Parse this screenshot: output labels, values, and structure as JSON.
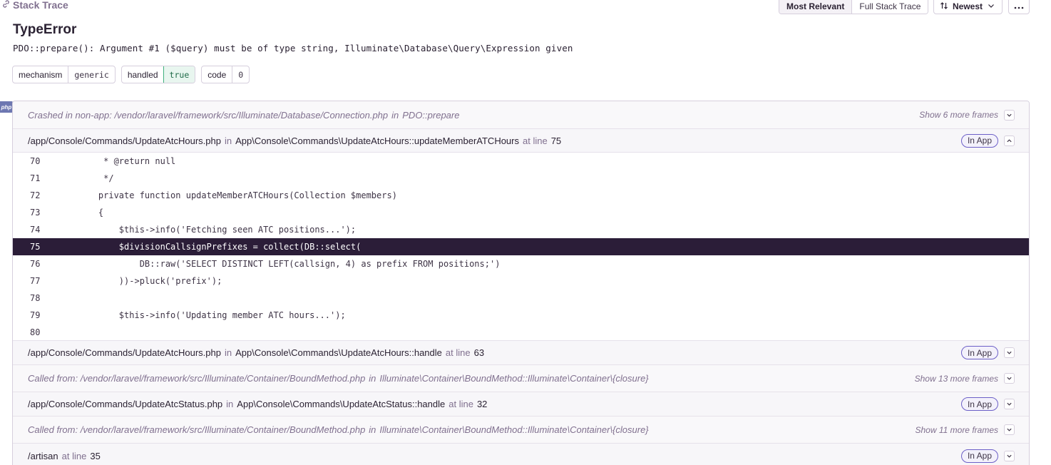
{
  "header": {
    "title": "Stack Trace",
    "view_options": [
      "Most Relevant",
      "Full Stack Trace"
    ],
    "sort_label": "Newest"
  },
  "error": {
    "type": "TypeError",
    "message": "PDO::prepare(): Argument #1 ($query) must be of type string, Illuminate\\Database\\Query\\Expression given"
  },
  "tags": [
    {
      "key": "mechanism",
      "value": "generic"
    },
    {
      "key": "handled",
      "value": "true"
    },
    {
      "key": "code",
      "value": "0"
    }
  ],
  "platform": "php",
  "frames": [
    {
      "kind": "system",
      "prefix": "Crashed in non-app:",
      "file": "/vendor/laravel/framework/src/Illuminate/Database/Connection.php",
      "in": "in",
      "function": "PDO::prepare",
      "more": "Show 6 more frames"
    },
    {
      "kind": "app",
      "file": "/app/Console/Commands/UpdateAtcHours.php",
      "in": "in",
      "function": "App\\Console\\Commands\\UpdateAtcHours::updateMemberATCHours",
      "at": "at line",
      "line": "75",
      "badge": "In App"
    },
    {
      "kind": "app",
      "file": "/app/Console/Commands/UpdateAtcHours.php",
      "in": "in",
      "function": "App\\Console\\Commands\\UpdateAtcHours::handle",
      "at": "at line",
      "line": "63",
      "badge": "In App"
    },
    {
      "kind": "system",
      "prefix": "Called from:",
      "file": "/vendor/laravel/framework/src/Illuminate/Container/BoundMethod.php",
      "in": "in",
      "function": "Illuminate\\Container\\BoundMethod::Illuminate\\Container\\{closure}",
      "more": "Show 13 more frames"
    },
    {
      "kind": "app",
      "file": "/app/Console/Commands/UpdateAtcStatus.php",
      "in": "in",
      "function": "App\\Console\\Commands\\UpdateAtcStatus::handle",
      "at": "at line",
      "line": "32",
      "badge": "In App"
    },
    {
      "kind": "system",
      "prefix": "Called from:",
      "file": "/vendor/laravel/framework/src/Illuminate/Container/BoundMethod.php",
      "in": "in",
      "function": "Illuminate\\Container\\BoundMethod::Illuminate\\Container\\{closure}",
      "more": "Show 11 more frames"
    },
    {
      "kind": "app",
      "file": "/artisan",
      "at": "at line",
      "line": "35",
      "badge": "In App"
    }
  ],
  "code_context": [
    {
      "line": "70",
      "code": "     * @return null",
      "active": false
    },
    {
      "line": "71",
      "code": "     */",
      "active": false
    },
    {
      "line": "72",
      "code": "    private function updateMemberATCHours(Collection $members)",
      "active": false
    },
    {
      "line": "73",
      "code": "    {",
      "active": false
    },
    {
      "line": "74",
      "code": "        $this->info('Fetching seen ATC positions...');",
      "active": false
    },
    {
      "line": "75",
      "code": "        $divisionCallsignPrefixes = collect(DB::select(",
      "active": true
    },
    {
      "line": "76",
      "code": "            DB::raw('SELECT DISTINCT LEFT(callsign, 4) as prefix FROM positions;')",
      "active": false
    },
    {
      "line": "77",
      "code": "        ))->pluck('prefix');",
      "active": false
    },
    {
      "line": "78",
      "code": "",
      "active": false
    },
    {
      "line": "79",
      "code": "        $this->info('Updating member ATC hours...');",
      "active": false
    },
    {
      "line": "80",
      "code": "",
      "active": false
    }
  ],
  "icons": {
    "title": "link-icon",
    "sort": "sort-arrows-icon",
    "more": "ellipsis-icon",
    "collapse": "chevron-up-icon",
    "expand": "chevron-down-icon"
  }
}
